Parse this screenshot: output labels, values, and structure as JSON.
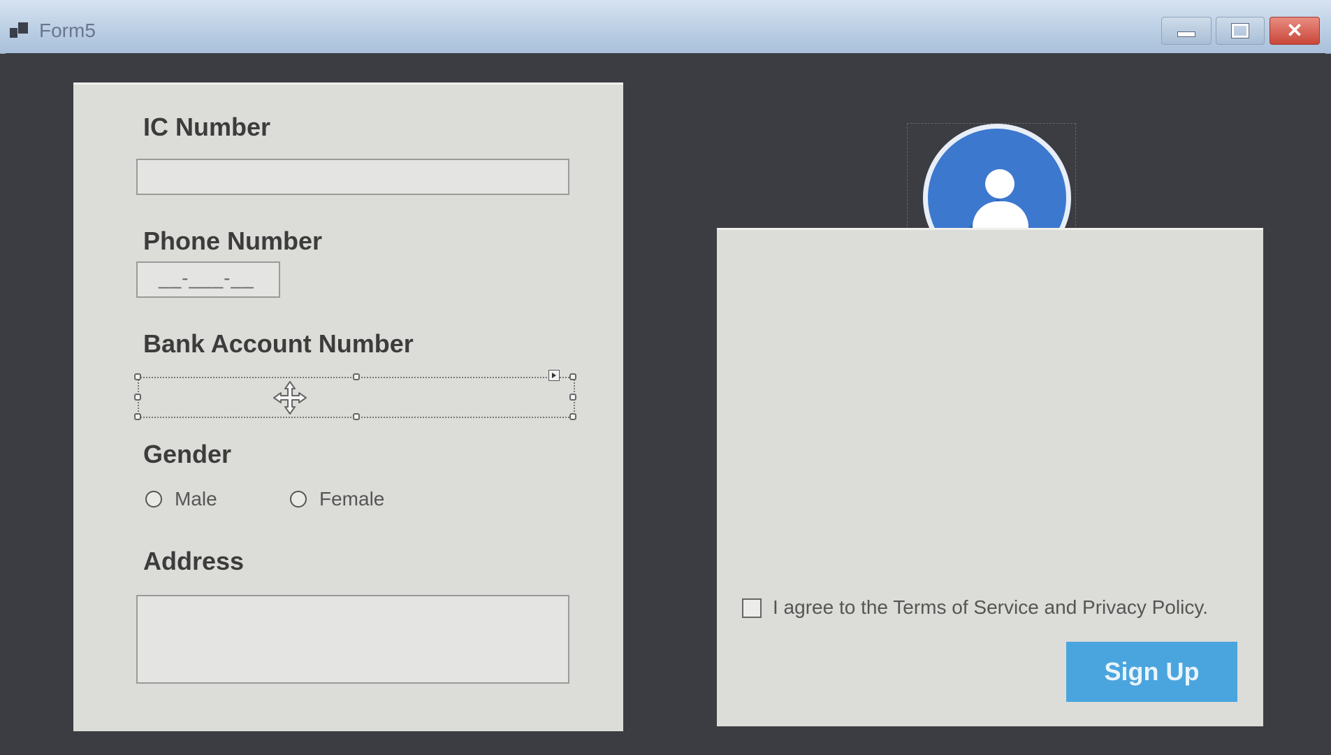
{
  "window": {
    "title": "Form5",
    "controls": {
      "minimize": "minimize-icon",
      "maximize": "maximize-icon",
      "close": "close-icon"
    }
  },
  "form": {
    "ic_number": {
      "label": "IC Number",
      "value": ""
    },
    "phone_number": {
      "label": "Phone Number",
      "mask": "__-___-__"
    },
    "bank_account": {
      "label": "Bank Account Number",
      "value": ""
    },
    "gender": {
      "label": "Gender",
      "options": [
        {
          "label": "Male",
          "selected": false
        },
        {
          "label": "Female",
          "selected": false
        }
      ]
    },
    "address": {
      "label": "Address",
      "value": ""
    }
  },
  "right_panel": {
    "avatar_icon": "user-avatar-icon",
    "terms_checkbox": {
      "label": "I agree to the Terms of Service and Privacy Policy.",
      "checked": false
    },
    "signup_button": {
      "label": "Sign Up"
    }
  },
  "colors": {
    "titlebar": "#b9cde3",
    "background": "#3b3d42",
    "panel": "#dcdcd8",
    "avatar": "#3d78cf",
    "button": "#4aa5de",
    "close_button": "#c9473a"
  }
}
